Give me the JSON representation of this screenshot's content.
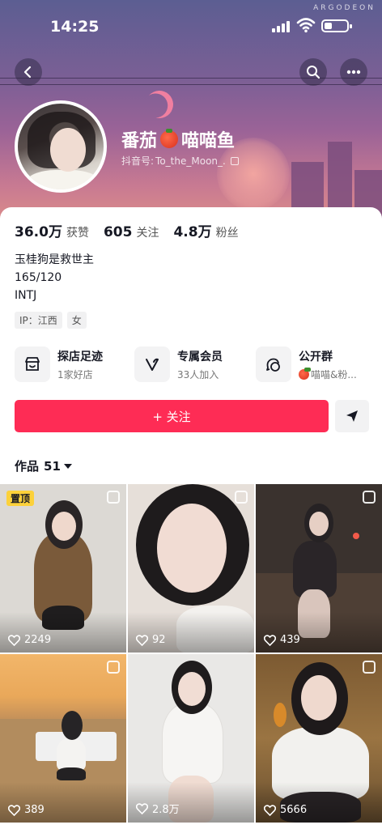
{
  "status_bar": {
    "time": "14:25",
    "watermark": "ARGODEON"
  },
  "profile": {
    "nickname_prefix": "番茄",
    "nickname_suffix": "喵喵鱼",
    "douyin_id_label": "抖音号:",
    "douyin_id": "To_the_Moon_."
  },
  "stats": [
    {
      "value": "36.0万",
      "label": "获赞"
    },
    {
      "value": "605",
      "label": "关注"
    },
    {
      "value": "4.8万",
      "label": "粉丝"
    }
  ],
  "bio": {
    "line1": "玉桂狗是救世主",
    "line2": "165/120",
    "line3": "INTJ"
  },
  "tags": {
    "ip": "IP：江西",
    "gender": "女"
  },
  "features": [
    {
      "title": "探店足迹",
      "subtitle": "1家好店",
      "icon": "shop-icon"
    },
    {
      "title": "专属会员",
      "subtitle": "33人加入",
      "icon": "vip-v-icon"
    },
    {
      "title": "公开群",
      "subtitle": "喵喵&粉...",
      "icon": "group-chat-icon"
    }
  ],
  "follow_button": {
    "label": "+ 关注"
  },
  "works": {
    "label": "作品",
    "count": "51"
  },
  "grid": [
    {
      "likes": "2249",
      "pinned": "置顶",
      "bg": "#d9d6d1",
      "accent": "#7a5a3a"
    },
    {
      "likes": "92",
      "pinned": "",
      "bg": "#e4ddd7",
      "accent": "#1e1b1c"
    },
    {
      "likes": "439",
      "pinned": "",
      "bg": "#3b3430",
      "accent": "#2a2528"
    },
    {
      "likes": "389",
      "pinned": "",
      "bg": "#c89a62",
      "accent": "#262426"
    },
    {
      "likes": "2.8万",
      "pinned": "",
      "bg": "#e8e7e5",
      "accent": "#f4f3f1"
    },
    {
      "likes": "5666",
      "pinned": "",
      "bg": "#8a6a3a",
      "accent": "#f2f1ee"
    }
  ]
}
